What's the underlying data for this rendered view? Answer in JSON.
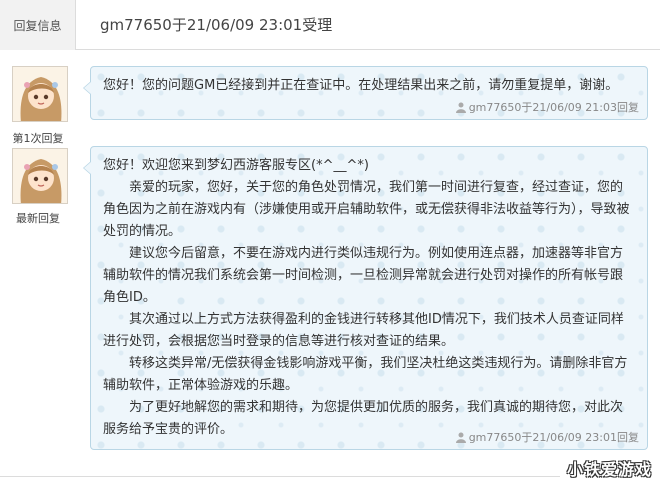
{
  "header": {
    "label": "回复信息",
    "title": "gm77650于21/06/09 23:01受理"
  },
  "replies": [
    {
      "side_label": "第1次回复",
      "avatar_icon": "avatar-girl-icon",
      "paragraphs": [
        "您好！您的问题GM已经接到并正在查证中。在处理结果出来之前，请勿重复提单，谢谢。"
      ],
      "stamp": "gm77650于21/06/09 21:03回复"
    },
    {
      "side_label": "最新回复",
      "avatar_icon": "avatar-girl-icon",
      "paragraphs": [
        "您好！欢迎您来到梦幻西游客服专区(*^__^*)",
        "亲爱的玩家，您好，关于您的角色处罚情况，我们第一时间进行复查，经过查证，您的角色因为之前在游戏内有（涉嫌使用或开启辅助软件，或无偿获得非法收益等行为），导致被处罚的情况。",
        "建议您今后留意，不要在游戏内进行类似违规行为。例如使用连点器，加速器等非官方辅助软件的情况我们系统会第一时间检测，一旦检测异常就会进行处罚对操作的所有帐号跟角色ID。",
        "其次通过以上方式方法获得盈利的金钱进行转移其他ID情况下，我们技术人员查证同样进行处罚，会根据您当时登录的信息等进行核对查证的结果。",
        "转移这类异常/无偿获得金钱影响游戏平衡，我们坚决杜绝这类违规行为。请删除非官方辅助软件，正常体验游戏的乐趣。",
        "为了更好地解您的需求和期待，为您提供更加优质的服务，我们真诚的期待您，对此次服务给予宝贵的评价。"
      ],
      "stamp": "gm77650于21/06/09 23:01回复"
    }
  ],
  "watermark": "小铁爱游戏",
  "colors": {
    "bubble_bg": "#eef6fb",
    "bubble_border": "#b9d6e5",
    "header_bg": "#f2f2f2"
  }
}
